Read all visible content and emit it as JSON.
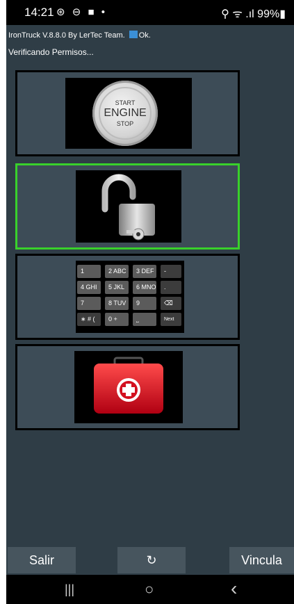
{
  "status_bar": {
    "time": "14:21",
    "left_icons": "⊛ ⊖ ■ •",
    "right_text": "⚲ ᯤ .ıl 99%▮"
  },
  "app": {
    "info_line": "IronTruck  V.8.8.0  By LerTec Team.",
    "info_status": "Ok.",
    "status_message": "Verificando Permisos..."
  },
  "panels": [
    {
      "name": "start-engine",
      "icon": "start-engine-button-icon",
      "selected": false
    },
    {
      "name": "unlock",
      "icon": "unlocked-padlock-icon",
      "selected": true
    },
    {
      "name": "keypad",
      "icon": "numeric-keypad-icon",
      "selected": false
    },
    {
      "name": "first-aid",
      "icon": "first-aid-kit-icon",
      "selected": false
    }
  ],
  "start_button": {
    "line1": "START",
    "line2": "ENGINE",
    "line3": "STOP"
  },
  "keypad": {
    "keys": [
      "1",
      "2 ABC",
      "3 DEF",
      "-",
      "4 GHI",
      "5 JKL",
      "6 MNO",
      ".",
      "7 PQRS",
      "8 TUV",
      "9 WXYZ",
      "⌫",
      "∗ # (",
      "0 +",
      "⎵",
      "Next"
    ]
  },
  "buttons": {
    "salir": "Salir",
    "refresh": "↻",
    "vincula": "Vincula"
  },
  "nav": {
    "recents": "|||",
    "home": "○",
    "back": "‹"
  },
  "colors": {
    "background": "#2f3d46",
    "panel": "#3d4c57",
    "selected_border": "#39d12b",
    "button": "#47555e"
  }
}
